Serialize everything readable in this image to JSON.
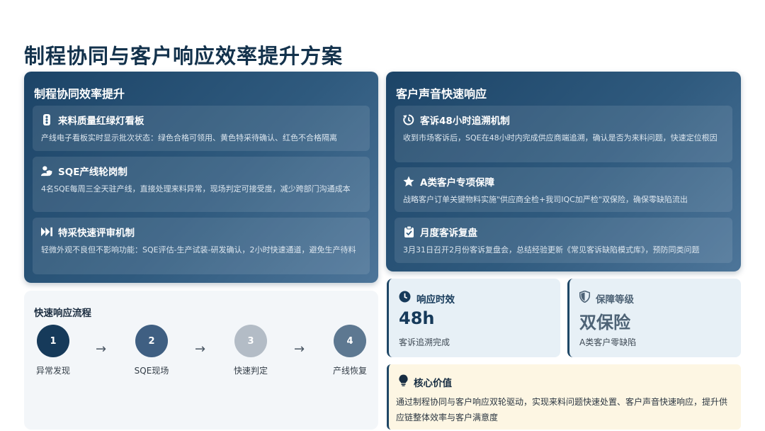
{
  "page": {
    "title": "制程协同与客户响应效率提升方案"
  },
  "left_panel": {
    "title": "制程协同效率提升",
    "items": [
      {
        "icon": "traffic-light-icon",
        "title": "来料质量红绿灯看板",
        "desc": "产线电子看板实时显示批次状态：绿色合格可领用、黄色特采待确认、红色不合格隔离"
      },
      {
        "icon": "user-shield-icon",
        "title": "SQE产线轮岗制",
        "desc": "4名SQE每周三全天驻产线，直接处理来料异常，现场判定可接受度，减少跨部门沟通成本"
      },
      {
        "icon": "fast-forward-icon",
        "title": "特采快速评审机制",
        "desc": "轻微外观不良但不影响功能：SQE评估-生产试装-研发确认，2小时快速通道，避免生产待料"
      }
    ]
  },
  "right_panel": {
    "title": "客户声音快速响应",
    "items": [
      {
        "icon": "history-icon",
        "title": "客诉48小时追溯机制",
        "desc": "收到市场客诉后，SQE在48小时内完成供应商端追溯，确认是否为来料问题，快速定位根因"
      },
      {
        "icon": "star-icon",
        "title": "A类客户专项保障",
        "desc": "战略客户订单关键物料实施\"供应商全检+我司IQC加严检\"双保险，确保零缺陷流出"
      },
      {
        "icon": "clipboard-check-icon",
        "title": "月度客诉复盘",
        "desc": "3月31日召开2月份客诉复盘会，总结经验更新《常见客诉缺陷模式库》，预防同类问题"
      }
    ]
  },
  "flow": {
    "title": "快速响应流程",
    "steps": [
      {
        "number": "1",
        "label": "异常发现",
        "color": "#163a5a"
      },
      {
        "number": "2",
        "label": "SQE现场",
        "color": "#3f5f82"
      },
      {
        "number": "3",
        "label": "快速判定",
        "color": "#b3bcc6"
      },
      {
        "number": "4",
        "label": "产线恢复",
        "color": "#5d7891"
      }
    ],
    "arrow": "→"
  },
  "stats": [
    {
      "icon": "clock-icon",
      "title": "响应时效",
      "value": "48h",
      "sub": "客诉追溯完成"
    },
    {
      "icon": "shield-icon",
      "title": "保障等级",
      "value": "双保险",
      "sub": "A类客户零缺陷"
    }
  ],
  "core": {
    "icon": "lightbulb-icon",
    "title": "核心价值",
    "text": "通过制程协同与客户响应双轮驱动，实现来料问题快速处置、客户声音快速响应，提升供应链整体效率与客户满意度"
  }
}
